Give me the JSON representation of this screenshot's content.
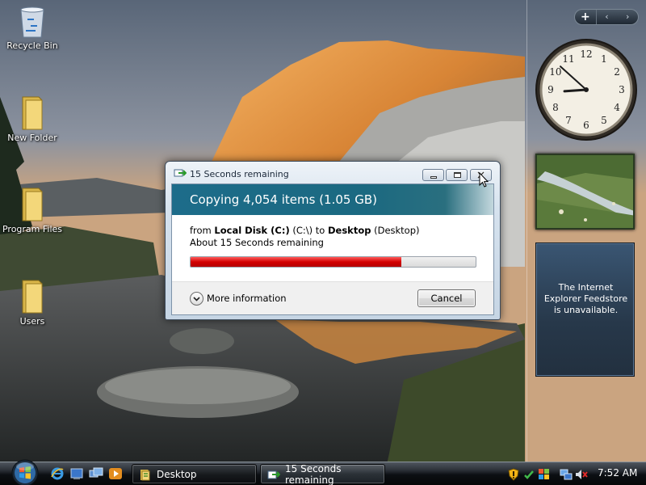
{
  "desktop": {
    "icons": [
      {
        "label": "Recycle Bin",
        "icon": "recycle-bin-icon"
      },
      {
        "label": "New Folder",
        "icon": "folder-icon"
      },
      {
        "label": "Program Files",
        "icon": "folder-icon"
      },
      {
        "label": "Users",
        "icon": "folder-icon"
      }
    ]
  },
  "sidebar": {
    "controls": {
      "add": "+",
      "prev": "‹",
      "next": "›"
    },
    "clock": {
      "hour": 8,
      "minute": 52
    },
    "feed": {
      "message": "The Internet Explorer Feedstore is unavailable."
    }
  },
  "dialog": {
    "title": "15 Seconds remaining",
    "heading": "Copying 4,054 items (1.05 GB)",
    "from_prefix": "from ",
    "source_name": "Local Disk (C:)",
    "source_path": " (C:\\) to ",
    "destination_name": "Desktop",
    "destination_path": " (Desktop)",
    "remaining_text": "About 15 Seconds remaining",
    "progress_fraction": 0.74,
    "more_info_label": "More information",
    "cancel_label": "Cancel"
  },
  "taskbar": {
    "tasks": [
      {
        "label": "Desktop",
        "icon": "folder-icon"
      },
      {
        "label": "15 Seconds remaining",
        "icon": "copy-icon"
      }
    ],
    "time": "7:52 AM"
  },
  "colors": {
    "progress": "#d20000",
    "dialog_header": "#1d6c8a"
  }
}
